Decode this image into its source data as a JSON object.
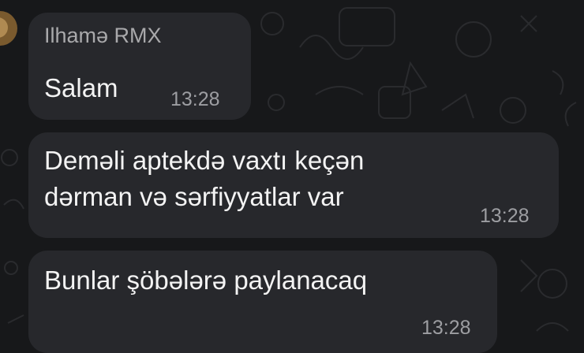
{
  "chat": {
    "messages": [
      {
        "sender": "Ilhamə RMX",
        "text": "Salam",
        "time": "13:28"
      },
      {
        "lines": [
          "Deməli aptekdə vaxtı keçən",
          "dərman və sərfiyyatlar var"
        ],
        "time": "13:28"
      },
      {
        "text": "Bunlar şöbələrə paylanacaq",
        "time": "13:28"
      }
    ]
  },
  "colors": {
    "background": "#17181a",
    "bubble": "#27282c",
    "sender_name": "#a9a9ab",
    "timestamp": "#9d9ea2"
  }
}
